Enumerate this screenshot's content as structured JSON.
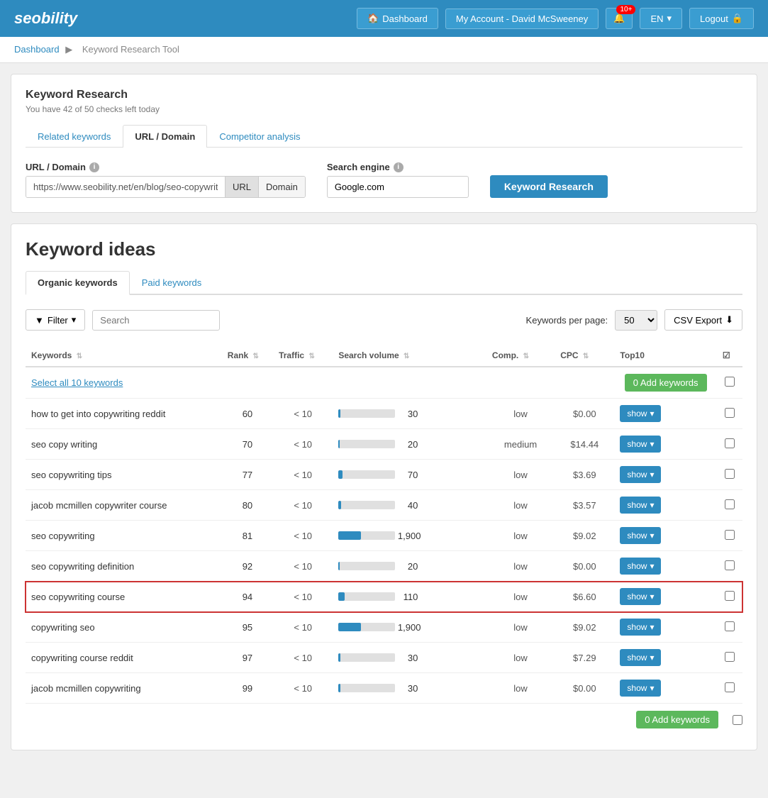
{
  "header": {
    "logo": "seobility",
    "dashboard_label": "Dashboard",
    "account_label": "My Account - David McSweeney",
    "notif_count": "10+",
    "lang": "EN",
    "logout_label": "Logout"
  },
  "breadcrumb": {
    "root": "Dashboard",
    "separator": "▶",
    "current": "Keyword Research Tool"
  },
  "keyword_research": {
    "title": "Keyword Research",
    "subtitle": "You have 42 of 50 checks left today",
    "tabs": [
      {
        "label": "Related keywords",
        "active": false
      },
      {
        "label": "URL / Domain",
        "active": true
      },
      {
        "label": "Competitor analysis",
        "active": false
      }
    ],
    "url_label": "URL / Domain",
    "url_value": "https://www.seobility.net/en/blog/seo-copywriting/",
    "url_btn": "URL",
    "domain_btn": "Domain",
    "search_engine_label": "Search engine",
    "search_engine_value": "Google.com",
    "research_btn": "Keyword Research"
  },
  "keyword_ideas": {
    "title": "Keyword ideas",
    "tabs": [
      {
        "label": "Organic keywords",
        "active": true
      },
      {
        "label": "Paid keywords",
        "active": false
      }
    ],
    "filter_btn": "Filter",
    "search_placeholder": "Search",
    "per_page_label": "Keywords per page:",
    "per_page_value": "50",
    "csv_export": "CSV Export",
    "table": {
      "headers": [
        "Keywords",
        "Rank",
        "Traffic",
        "Search volume",
        "Comp.",
        "CPC",
        "Top10",
        ""
      ],
      "select_all": "Select all 10 keywords",
      "add_keywords_label": "0 Add keywords",
      "rows": [
        {
          "keyword": "how to get into copywriting reddit",
          "rank": 60,
          "traffic": "< 10",
          "sv": 30,
          "sv_pct": 3,
          "comp": "low",
          "cpc": "$0.00",
          "highlighted": false
        },
        {
          "keyword": "seo copy writing",
          "rank": 70,
          "traffic": "< 10",
          "sv": 20,
          "sv_pct": 2,
          "comp": "medium",
          "cpc": "$14.44",
          "highlighted": false
        },
        {
          "keyword": "seo copywriting tips",
          "rank": 77,
          "traffic": "< 10",
          "sv": 70,
          "sv_pct": 7,
          "comp": "low",
          "cpc": "$3.69",
          "highlighted": false
        },
        {
          "keyword": "jacob mcmillen copywriter course",
          "rank": 80,
          "traffic": "< 10",
          "sv": 40,
          "sv_pct": 4,
          "comp": "low",
          "cpc": "$3.57",
          "highlighted": false
        },
        {
          "keyword": "seo copywriting",
          "rank": 81,
          "traffic": "< 10",
          "sv": 1900,
          "sv_pct": 40,
          "comp": "low",
          "cpc": "$9.02",
          "highlighted": false
        },
        {
          "keyword": "seo copywriting definition",
          "rank": 92,
          "traffic": "< 10",
          "sv": 20,
          "sv_pct": 2,
          "comp": "low",
          "cpc": "$0.00",
          "highlighted": false
        },
        {
          "keyword": "seo copywriting course",
          "rank": 94,
          "traffic": "< 10",
          "sv": 110,
          "sv_pct": 11,
          "comp": "low",
          "cpc": "$6.60",
          "highlighted": true
        },
        {
          "keyword": "copywriting seo",
          "rank": 95,
          "traffic": "< 10",
          "sv": 1900,
          "sv_pct": 40,
          "comp": "low",
          "cpc": "$9.02",
          "highlighted": false
        },
        {
          "keyword": "copywriting course reddit",
          "rank": 97,
          "traffic": "< 10",
          "sv": 30,
          "sv_pct": 3,
          "comp": "low",
          "cpc": "$7.29",
          "highlighted": false
        },
        {
          "keyword": "jacob mcmillen copywriting",
          "rank": 99,
          "traffic": "< 10",
          "sv": 30,
          "sv_pct": 3,
          "comp": "low",
          "cpc": "$0.00",
          "highlighted": false
        }
      ],
      "show_btn": "show",
      "bottom_add_label": "0 Add keywords"
    }
  }
}
